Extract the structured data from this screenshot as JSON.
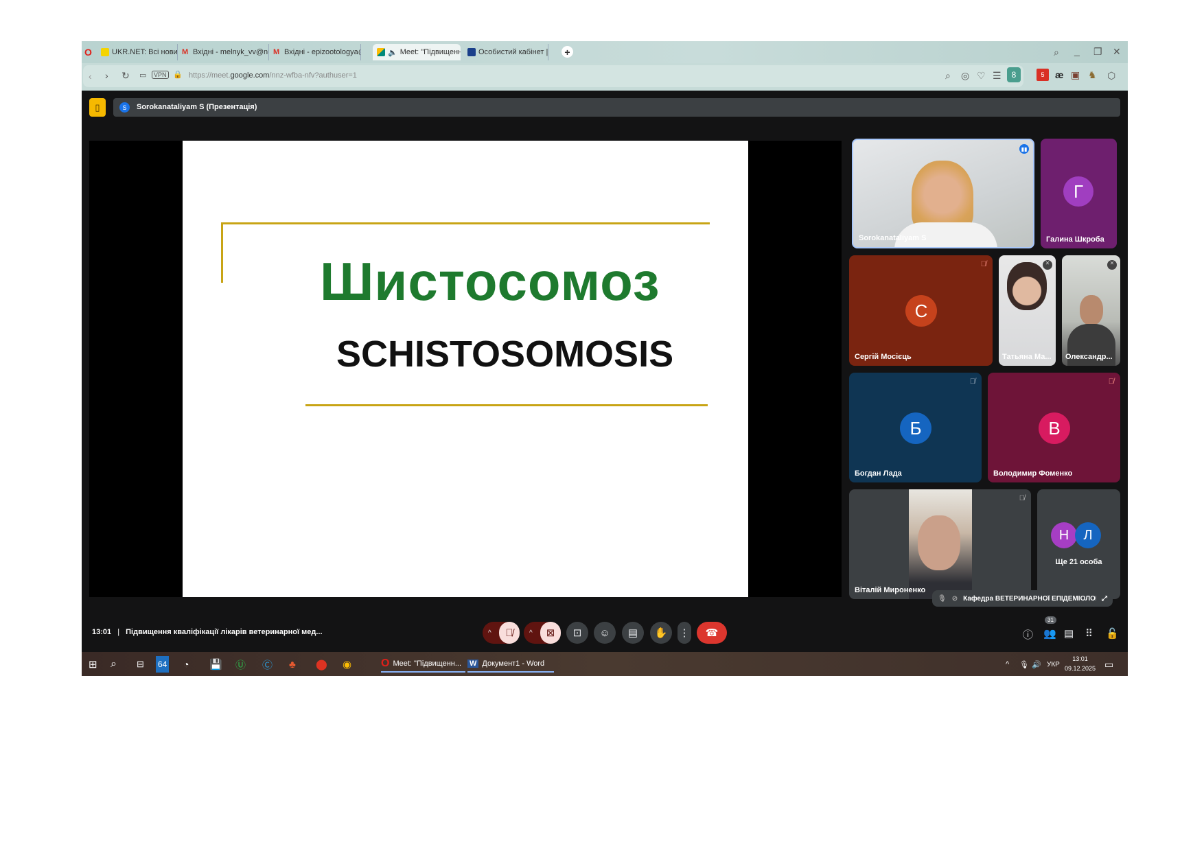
{
  "browser": {
    "tabs": [
      {
        "label": "UKR.NET: Всі новини Укр",
        "icon": "ukrnet-icon",
        "color": "#f5d400"
      },
      {
        "label": "Вхідні - melnyk_vv@nubi",
        "icon": "gmail-icon",
        "color": "#d93025"
      },
      {
        "label": "Вхідні - epizootologya@g",
        "icon": "gmail-icon",
        "color": "#d93025"
      },
      {
        "label": "Meet: \"Підвищенн",
        "icon": "meet-icon",
        "color": "#00897b",
        "active": true
      },
      {
        "label": "Особистий кабінет | Нав",
        "icon": "university-icon",
        "color": "#1a3f8a"
      }
    ],
    "url_prefix": "https://meet.",
    "url_domain": "google.com",
    "url_path": "/nnz-wfba-nfv?authuser=1",
    "vpn_label": "VPN",
    "ext_badge_1": "5",
    "ext_text": "æ"
  },
  "meet": {
    "presenter_label": "Sorokanataliyam S (Презентація)",
    "presenter_initial": "S",
    "slide": {
      "title": "Шистосомоз",
      "subtitle": "SCHISTOSOMOSIS",
      "title_color": "#1e7a2e",
      "line_color": "#c8a415"
    },
    "participants": [
      {
        "name": "Sorokanataliyam S",
        "type": "video"
      },
      {
        "name": "Галина Шкроба",
        "initial": "Г",
        "bg": "#6e1f6e",
        "avatar": "#a03ec0"
      },
      {
        "name": "Сергій Мосієць",
        "initial": "С",
        "bg": "#7a2410",
        "avatar": "#c6421c"
      },
      {
        "name": "Татьяна Ма...",
        "type": "video"
      },
      {
        "name": "Олександр...",
        "type": "video"
      },
      {
        "name": "Богдан Лада",
        "initial": "Б",
        "bg": "#0f3553",
        "avatar": "#1565c0"
      },
      {
        "name": "Володимир Фоменко",
        "initial": "В",
        "bg": "#6e1438",
        "avatar": "#d81b60"
      },
      {
        "name": "Віталій Мироненко",
        "type": "video"
      }
    ],
    "more": {
      "label": "Ще 21 особа",
      "initials": [
        "Н",
        "Л"
      ],
      "colors": [
        "#a63ec4",
        "#1565c0"
      ]
    },
    "self_view_label": "Кафедра ВЕТЕРИНАРНОЇ ЕПІДЕМІОЛОГІ...",
    "time": "13:01",
    "separator": "|",
    "meeting_title": "Підвищення кваліфікації лікарів ветеринарної мед...",
    "participant_count": "31"
  },
  "taskbar": {
    "badge_64": "64",
    "apps": [
      {
        "label": "Meet: \"Підвищенн..."
      },
      {
        "label": "Документ1 - Word"
      }
    ],
    "lang": "УКР",
    "clock_time": "13:01",
    "clock_date": "09.12.2025"
  }
}
